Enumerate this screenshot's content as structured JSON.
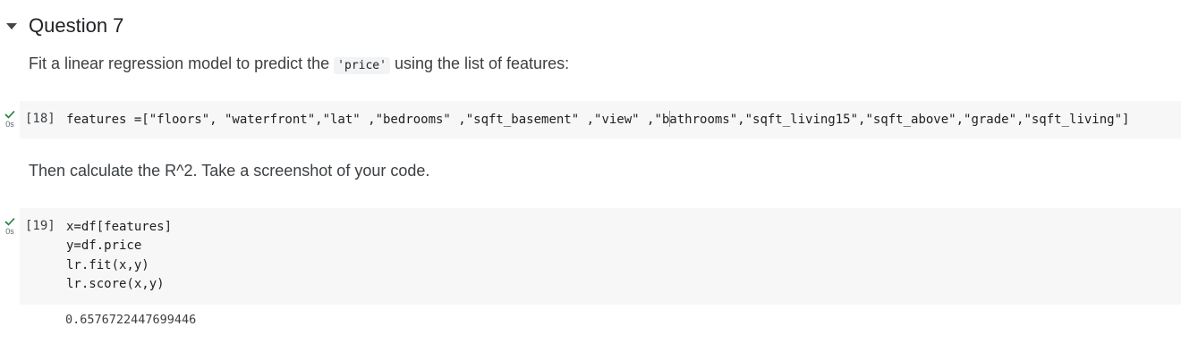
{
  "section": {
    "title": "Question 7"
  },
  "text_cell_1": {
    "prefix": "Fit a linear regression model to predict the ",
    "code": "'price'",
    "suffix": " using the list of features:"
  },
  "cell_18": {
    "exec_count": "[18]",
    "exec_time": "0s",
    "code_before_cursor": "features =[\"floors\", \"waterfront\",\"lat\" ,\"bedrooms\" ,\"sqft_basement\" ,\"view\" ,\"b",
    "code_after_cursor": "athrooms\",\"sqft_living15\",\"sqft_above\",\"grade\",\"sqft_living\"]"
  },
  "text_cell_2": {
    "text": "Then calculate the R^2. Take a screenshot of your code."
  },
  "cell_19": {
    "exec_count": "[19]",
    "exec_time": "0s",
    "code": "x=df[features]\ny=df.price\nlr.fit(x,y)\nlr.score(x,y)",
    "output": "0.6576722447699446"
  },
  "colors": {
    "check": "#188038",
    "code_bg": "#f7f7f7"
  },
  "icons": {
    "toggle": "caret-down-icon",
    "status": "check-icon"
  }
}
